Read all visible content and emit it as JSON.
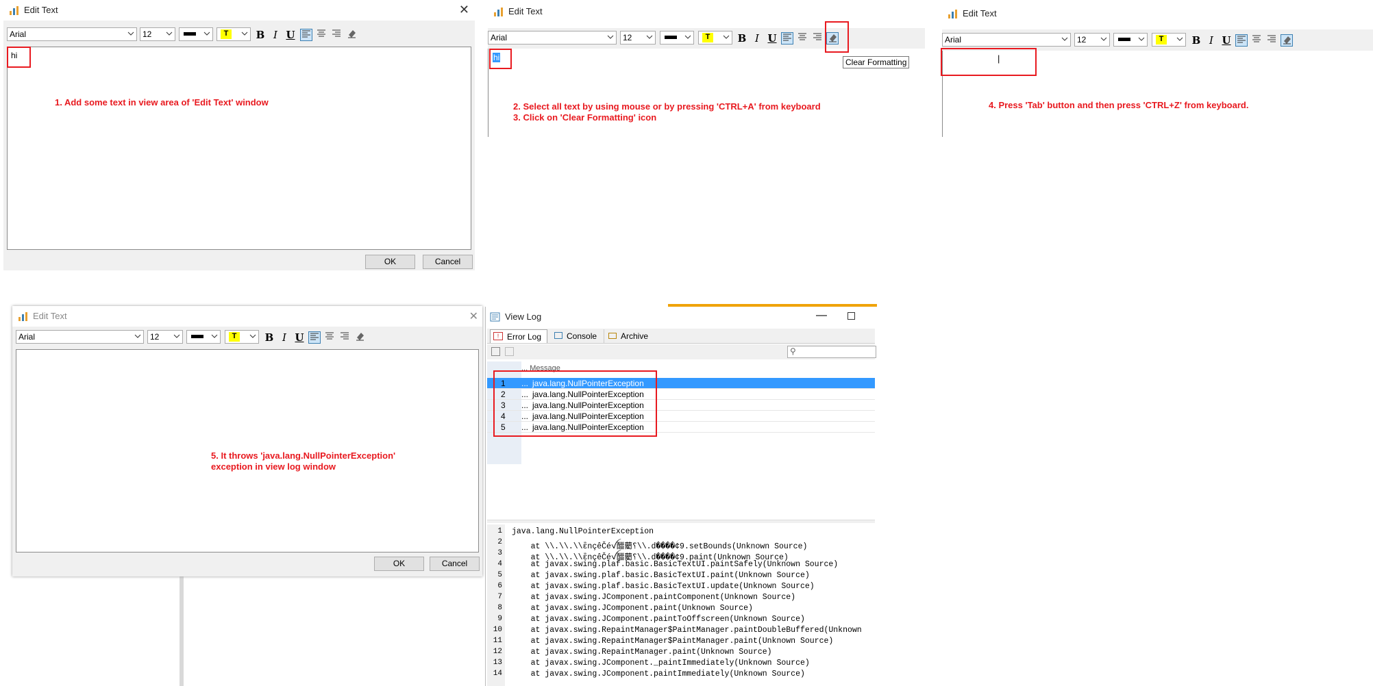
{
  "edit_text": {
    "title": "Edit Text",
    "font_name": "Arial",
    "font_size": "12",
    "highlight_glyph": "T",
    "ok_label": "OK",
    "cancel_label": "Cancel"
  },
  "panel1": {
    "text": "hi",
    "note": "1. Add some text in view area of 'Edit Text' window"
  },
  "panel2": {
    "text": "hi",
    "tooltip": "Clear Formatting",
    "note_line1": "2. Select all text by using mouse or by pressing 'CTRL+A' from keyboard",
    "note_line2": "3. Click on 'Clear Formatting' icon"
  },
  "panel3": {
    "cursor": "|",
    "note": "4. Press 'Tab' button and then press 'CTRL+Z' from keyboard."
  },
  "panel5": {
    "note_line1": "5. It throws 'java.lang.NullPointerException'",
    "note_line2": "exception in view log window"
  },
  "view_log": {
    "title": "View Log",
    "tabs": [
      "Error Log",
      "Console",
      "Archive"
    ],
    "column_header": "... Message",
    "rows": [
      {
        "num": "1",
        "dots": "...",
        "message": "java.lang.NullPointerException"
      },
      {
        "num": "2",
        "dots": "...",
        "message": "java.lang.NullPointerException"
      },
      {
        "num": "3",
        "dots": "...",
        "message": "java.lang.NullPointerException"
      },
      {
        "num": "4",
        "dots": "...",
        "message": "java.lang.NullPointerException"
      },
      {
        "num": "5",
        "dots": "...",
        "message": "java.lang.NullPointerException"
      }
    ],
    "stack_trace": [
      {
        "num": "1",
        "text": "java.lang.NullPointerException"
      },
      {
        "num": "2",
        "text": "    at \\\\.\\\\.\\\\ἒnçêČéꪜ醋藺؟\\\\.d����¢9.setBounds(Unknown Source)"
      },
      {
        "num": "3",
        "text": "    at \\\\.\\\\.\\\\ἒnçêČéꪜ醋藺؟\\\\.d����¢9.paint(Unknown Source)"
      },
      {
        "num": "4",
        "text": "    at javax.swing.plaf.basic.BasicTextUI.paintSafely(Unknown Source)"
      },
      {
        "num": "5",
        "text": "    at javax.swing.plaf.basic.BasicTextUI.paint(Unknown Source)"
      },
      {
        "num": "6",
        "text": "    at javax.swing.plaf.basic.BasicTextUI.update(Unknown Source)"
      },
      {
        "num": "7",
        "text": "    at javax.swing.JComponent.paintComponent(Unknown Source)"
      },
      {
        "num": "8",
        "text": "    at javax.swing.JComponent.paint(Unknown Source)"
      },
      {
        "num": "9",
        "text": "    at javax.swing.JComponent.paintToOffscreen(Unknown Source)"
      },
      {
        "num": "10",
        "text": "    at javax.swing.RepaintManager$PaintManager.paintDoubleBuffered(Unknown"
      },
      {
        "num": "11",
        "text": "    at javax.swing.RepaintManager$PaintManager.paint(Unknown Source)"
      },
      {
        "num": "12",
        "text": "    at javax.swing.RepaintManager.paint(Unknown Source)"
      },
      {
        "num": "13",
        "text": "    at javax.swing.JComponent._paintImmediately(Unknown Source)"
      },
      {
        "num": "14",
        "text": "    at javax.swing.JComponent.paintImmediately(Unknown Source)"
      }
    ]
  },
  "colors": {
    "accent": "#e8191f",
    "selection": "#3399ff",
    "orange_strip": "#f0a30a"
  }
}
